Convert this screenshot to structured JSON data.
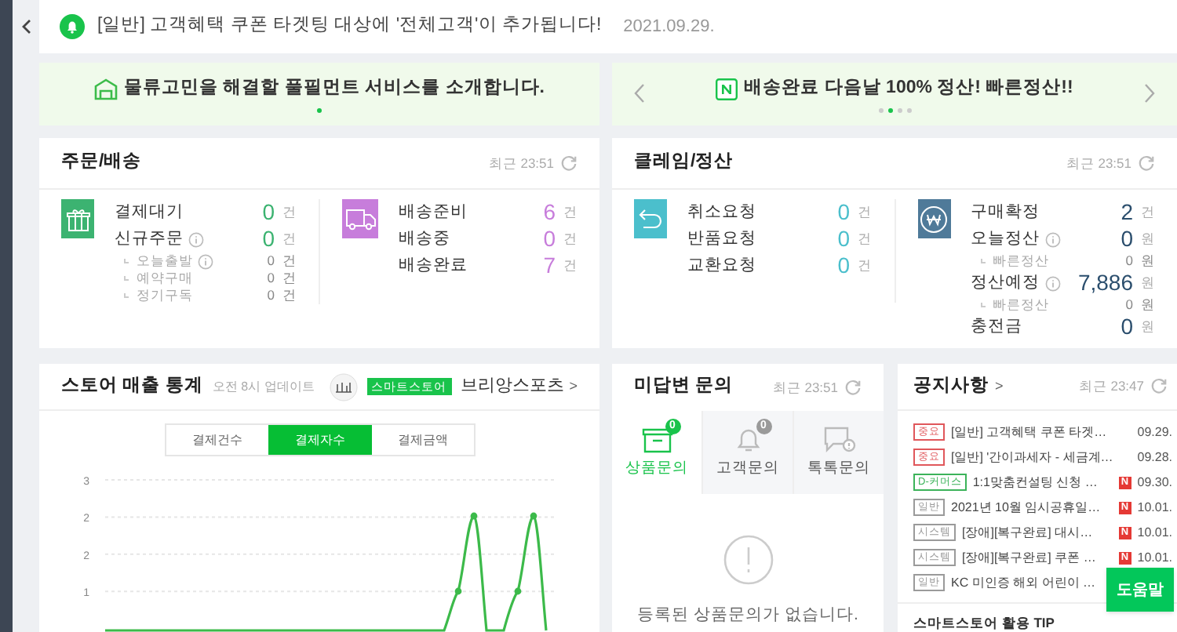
{
  "notice_bar": {
    "text": "[일반] 고객혜택 쿠폰 타겟팅 대상에 '전체고객'이 추가됩니다!",
    "date": "2021.09.29."
  },
  "banners": [
    {
      "kind": "warehouse",
      "text": "물류고민을 해결할 풀필먼트 서비스를 소개합니다.",
      "arrows": false,
      "dots": [
        {
          "selected": true
        }
      ]
    },
    {
      "kind": "n",
      "text": "배송완료 다음날 100% 정산! 빠른정산!!",
      "arrows": true,
      "dots": [
        {
          "selected": false
        },
        {
          "selected": true
        },
        {
          "selected": false
        },
        {
          "selected": false
        }
      ]
    }
  ],
  "status_panels": [
    {
      "title": "주문/배송",
      "updated": "최근 23:51",
      "groups": [
        {
          "kind": "gift",
          "color": "#3cb371",
          "rows": [
            {
              "kind": "main",
              "label": "결제대기",
              "info": false,
              "value": "0",
              "unit": "건"
            },
            {
              "kind": "main",
              "label": "신규주문",
              "info": true,
              "value": "0",
              "unit": "건"
            },
            {
              "kind": "sub",
              "label": "오늘출발",
              "info": true,
              "value": "0",
              "unit": "건"
            },
            {
              "kind": "sub",
              "label": "예약구매",
              "info": false,
              "value": "0",
              "unit": "건"
            },
            {
              "kind": "sub",
              "label": "정기구독",
              "info": false,
              "value": "0",
              "unit": "건"
            }
          ]
        },
        {
          "kind": "truck",
          "color": "#c77ddb",
          "rows": [
            {
              "kind": "main",
              "label": "배송준비",
              "info": false,
              "value": "6",
              "unit": "건"
            },
            {
              "kind": "main",
              "label": "배송중",
              "info": false,
              "value": "0",
              "unit": "건"
            },
            {
              "kind": "main",
              "label": "배송완료",
              "info": false,
              "value": "7",
              "unit": "건"
            }
          ]
        }
      ]
    },
    {
      "title": "클레임/정산",
      "updated": "최근 23:51",
      "groups": [
        {
          "kind": "return",
          "color": "#4bbfcc",
          "rows": [
            {
              "kind": "main",
              "label": "취소요청",
              "info": false,
              "value": "0",
              "unit": "건"
            },
            {
              "kind": "main",
              "label": "반품요청",
              "info": false,
              "value": "0",
              "unit": "건"
            },
            {
              "kind": "main",
              "label": "교환요청",
              "info": false,
              "value": "0",
              "unit": "건"
            }
          ]
        },
        {
          "kind": "won",
          "color": "#4f7a99",
          "rows": [
            {
              "kind": "main",
              "label": "구매확정",
              "info": false,
              "value": "2",
              "unit": "건"
            },
            {
              "kind": "main",
              "label": "오늘정산",
              "info": true,
              "value": "0",
              "unit": "원"
            },
            {
              "kind": "sub",
              "label": "빠른정산",
              "info": false,
              "value": "0",
              "unit": "원"
            },
            {
              "kind": "main",
              "label": "정산예정",
              "info": true,
              "value": "7,886",
              "unit": "원"
            },
            {
              "kind": "sub",
              "label": "빠른정산",
              "info": false,
              "value": "0",
              "unit": "원"
            },
            {
              "kind": "main",
              "label": "충전금",
              "info": false,
              "value": "0",
              "unit": "원"
            }
          ]
        }
      ]
    }
  ],
  "sales_stats": {
    "title": "스토어 매출 통계",
    "updated": "오전 8시 업데이트",
    "store_badge": "스마트스토어",
    "store_name": "브리앙스포츠",
    "store_chevron": ">",
    "tabs": [
      {
        "label": "결제건수",
        "selected": false
      },
      {
        "label": "결제자수",
        "selected": true
      },
      {
        "label": "결제금액",
        "selected": false
      }
    ],
    "y_axis_labels": [
      "3",
      "2",
      "2",
      "1"
    ]
  },
  "inquiries": {
    "title": "미답변 문의",
    "updated": "최근 23:51",
    "tabs": [
      {
        "kind": "box",
        "label": "상품문의",
        "badge": "0",
        "selected": true
      },
      {
        "kind": "bell",
        "label": "고객문의",
        "badge": "0",
        "selected": false
      },
      {
        "kind": "chat",
        "label": "톡톡문의",
        "selected": false
      }
    ],
    "empty_message": "등록된 상품문의가 없습니다."
  },
  "notices": {
    "title": "공지사항",
    "chevron": ">",
    "updated": "최근 23:47",
    "items": [
      {
        "tag": "중요",
        "color": "#e0575b",
        "title": "[일반] 고객혜택 쿠폰 타겟…",
        "date": "09.29."
      },
      {
        "tag": "중요",
        "color": "#e0575b",
        "title": "[일반] '간이과세자 - 세금계…",
        "date": "09.28."
      },
      {
        "tag": "D-커머스",
        "color": "#3cb35a",
        "title": "1:1맞춤컨설팅 신청 …",
        "new_badge": "N",
        "date": "09.30."
      },
      {
        "tag": "일반",
        "color": "#9a9a9a",
        "title": "2021년 10월 임시공휴일…",
        "new_badge": "N",
        "date": "10.01."
      },
      {
        "tag": "시스템",
        "color": "#9a9a9a",
        "title": "[장애][복구완료] 대시…",
        "new_badge": "N",
        "date": "10.01."
      },
      {
        "tag": "시스템",
        "color": "#9a9a9a",
        "title": "[장애][복구완료] 쿠폰 …",
        "new_badge": "N",
        "date": "10.01."
      },
      {
        "tag": "일반",
        "color": "#9a9a9a",
        "title": "KC 미인증 해외 어린이 …"
      }
    ],
    "footer": "스마트스토어 활용 TIP"
  },
  "help_button": "도움말"
}
